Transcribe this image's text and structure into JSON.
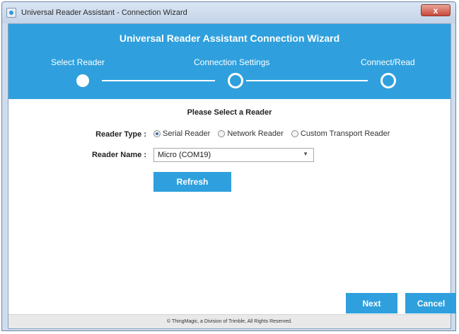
{
  "window": {
    "title": "Universal Reader Assistant - Connection Wizard",
    "close_glyph": "x"
  },
  "wizard": {
    "title": "Universal Reader Assistant Connection Wizard",
    "steps": [
      {
        "label": "Select Reader",
        "state": "active"
      },
      {
        "label": "Connection Settings",
        "state": "pending"
      },
      {
        "label": "Connect/Read",
        "state": "pending"
      }
    ]
  },
  "form": {
    "section_title": "Please Select a Reader",
    "reader_type_label": "Reader Type :",
    "reader_type_options": [
      {
        "label": "Serial Reader",
        "checked": true
      },
      {
        "label": "Network Reader",
        "checked": false
      },
      {
        "label": "Custom Transport Reader",
        "checked": false
      }
    ],
    "reader_name_label": "Reader Name :",
    "reader_name_value": "Micro (COM19)",
    "refresh_label": "Refresh"
  },
  "actions": {
    "next_label": "Next",
    "cancel_label": "Cancel"
  },
  "footer": {
    "text": "© ThingMagic, a Division of Trimble, All Rights Reserved."
  },
  "colors": {
    "accent": "#2fa0dd"
  }
}
